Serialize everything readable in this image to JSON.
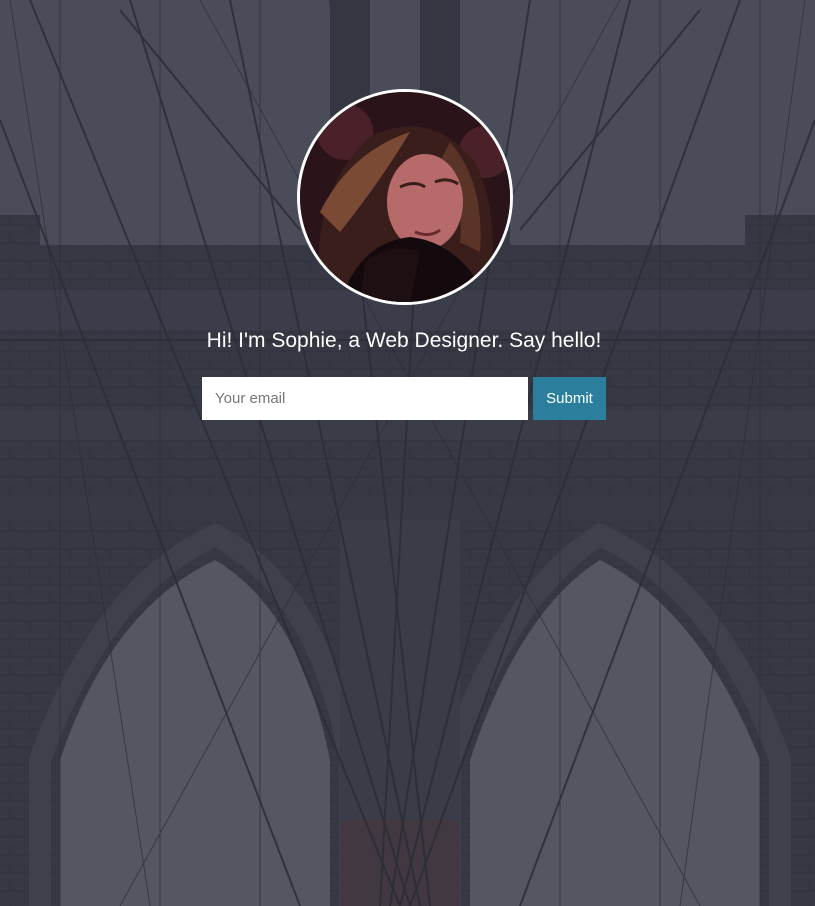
{
  "hero": {
    "tagline": "Hi! I'm Sophie, a Web Designer. Say hello!"
  },
  "signup": {
    "email_placeholder": "Your email",
    "email_value": "",
    "submit_label": "Submit"
  },
  "colors": {
    "overlay": "#3a3c47",
    "accent": "#2b7f9c",
    "text": "#ffffff"
  }
}
